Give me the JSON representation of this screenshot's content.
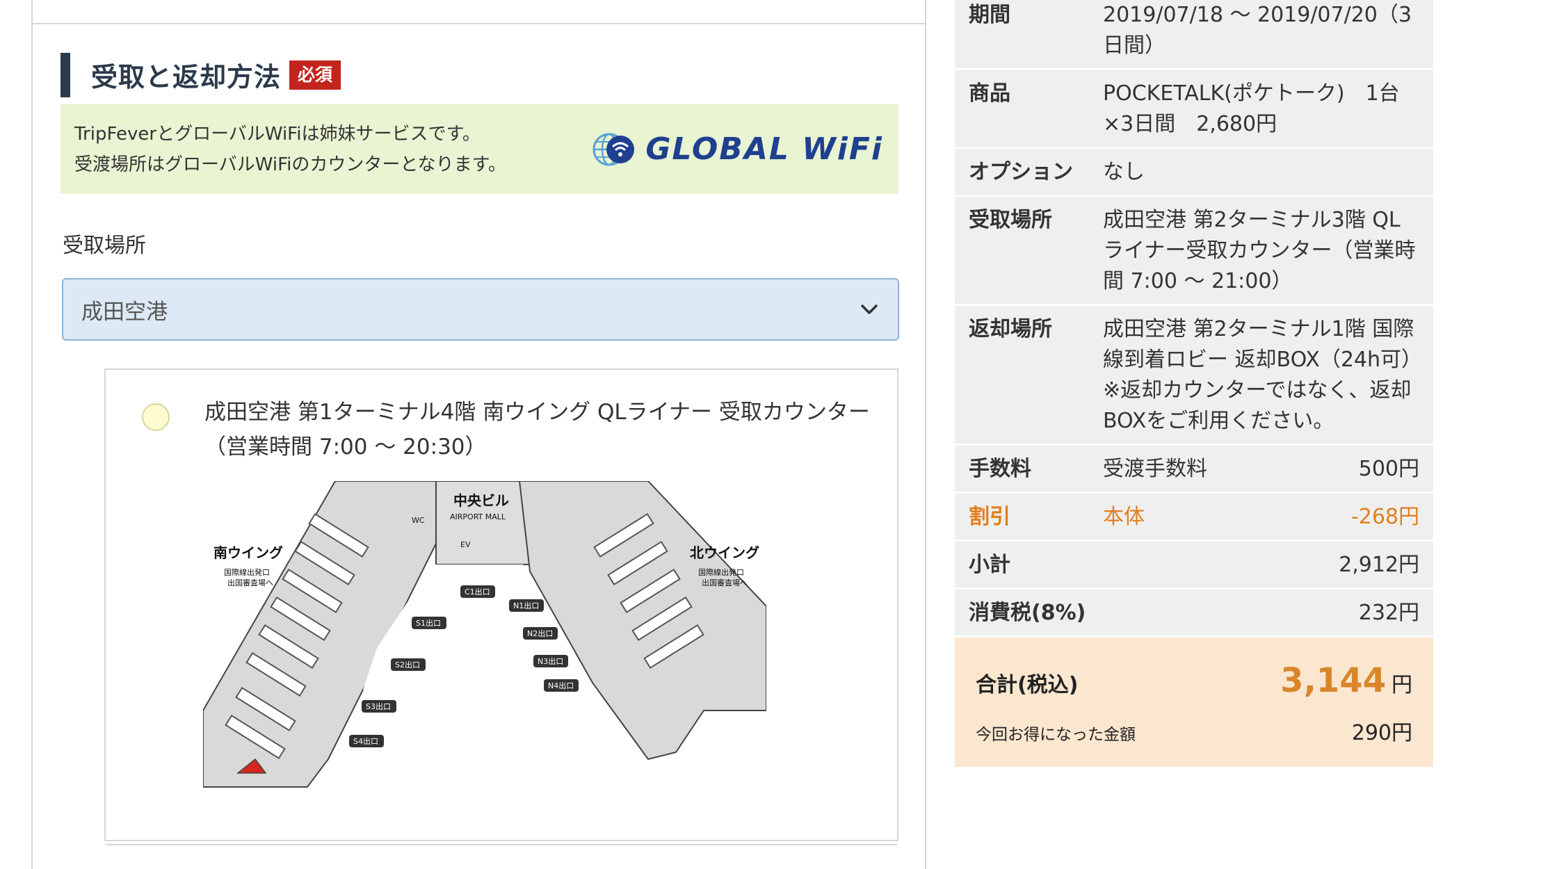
{
  "section": {
    "title": "受取と返却方法",
    "required_badge": "必須"
  },
  "notice": {
    "line1": "TripFeverとグローバルWiFiは姉妹サービスです。",
    "line2": "受渡場所はグローバルWiFiのカウンターとなります。",
    "brand": "GLOBAL WiFi"
  },
  "pickup": {
    "label": "受取場所",
    "selected": "成田空港"
  },
  "option": {
    "text": "成田空港 第1ターミナル4階 南ウイング QLライナー 受取カウンター（営業時間 7:00 〜 20:30）",
    "map_labels": {
      "center": "中央ビル",
      "mall": "AIRPORT MALL",
      "south": "南ウイング",
      "north": "北ウイング",
      "south_sub1": "国際線出発口",
      "south_sub2": "出国審査場へ",
      "north_sub1": "国際線出発口",
      "north_sub2": "出国審査場へ",
      "c1": "C1出口",
      "n1": "N1出口",
      "n2": "N2出口",
      "n3": "N3出口",
      "n4": "N4出口",
      "s1": "S1出口",
      "s2": "S2出口",
      "s3": "S3出口",
      "s4": "S4出口",
      "wc": "WC",
      "ev": "EV"
    }
  },
  "summary": {
    "period_label": "期間",
    "period_value": "2019/07/18 〜 2019/07/20（3日間）",
    "product_label": "商品",
    "product_value": "POCKETALK(ポケトーク)　1台×3日間　2,680円",
    "option_label": "オプション",
    "option_value": "なし",
    "pickup_label": "受取場所",
    "pickup_value": "成田空港 第2ターミナル3階 QLライナー受取カウンター（営業時間 7:00 〜 21:00）",
    "return_label": "返却場所",
    "return_value": "成田空港 第2ターミナル1階 国際線到着ロビー 返却BOX（24h可）※返却カウンターではなく、返却BOXをご利用ください。",
    "fee_label": "手数料",
    "fee_name": "受渡手数料",
    "fee_value": "500円",
    "discount_label": "割引",
    "discount_name": "本体",
    "discount_value": "-268円",
    "subtotal_label": "小計",
    "subtotal_value": "2,912円",
    "tax_label": "消費税(8%)",
    "tax_value": "232円",
    "total_label": "合計(税込)",
    "total_value": "3,144",
    "total_unit": "円",
    "savings_label": "今回お得になった金額",
    "savings_value": "290円"
  },
  "colors": {
    "accent_orange": "#e07f1d",
    "required_red": "#c3241d",
    "brand_blue": "#1f3f8f",
    "notice_green": "#e8f4d2",
    "total_bg": "#fbe6cf"
  }
}
